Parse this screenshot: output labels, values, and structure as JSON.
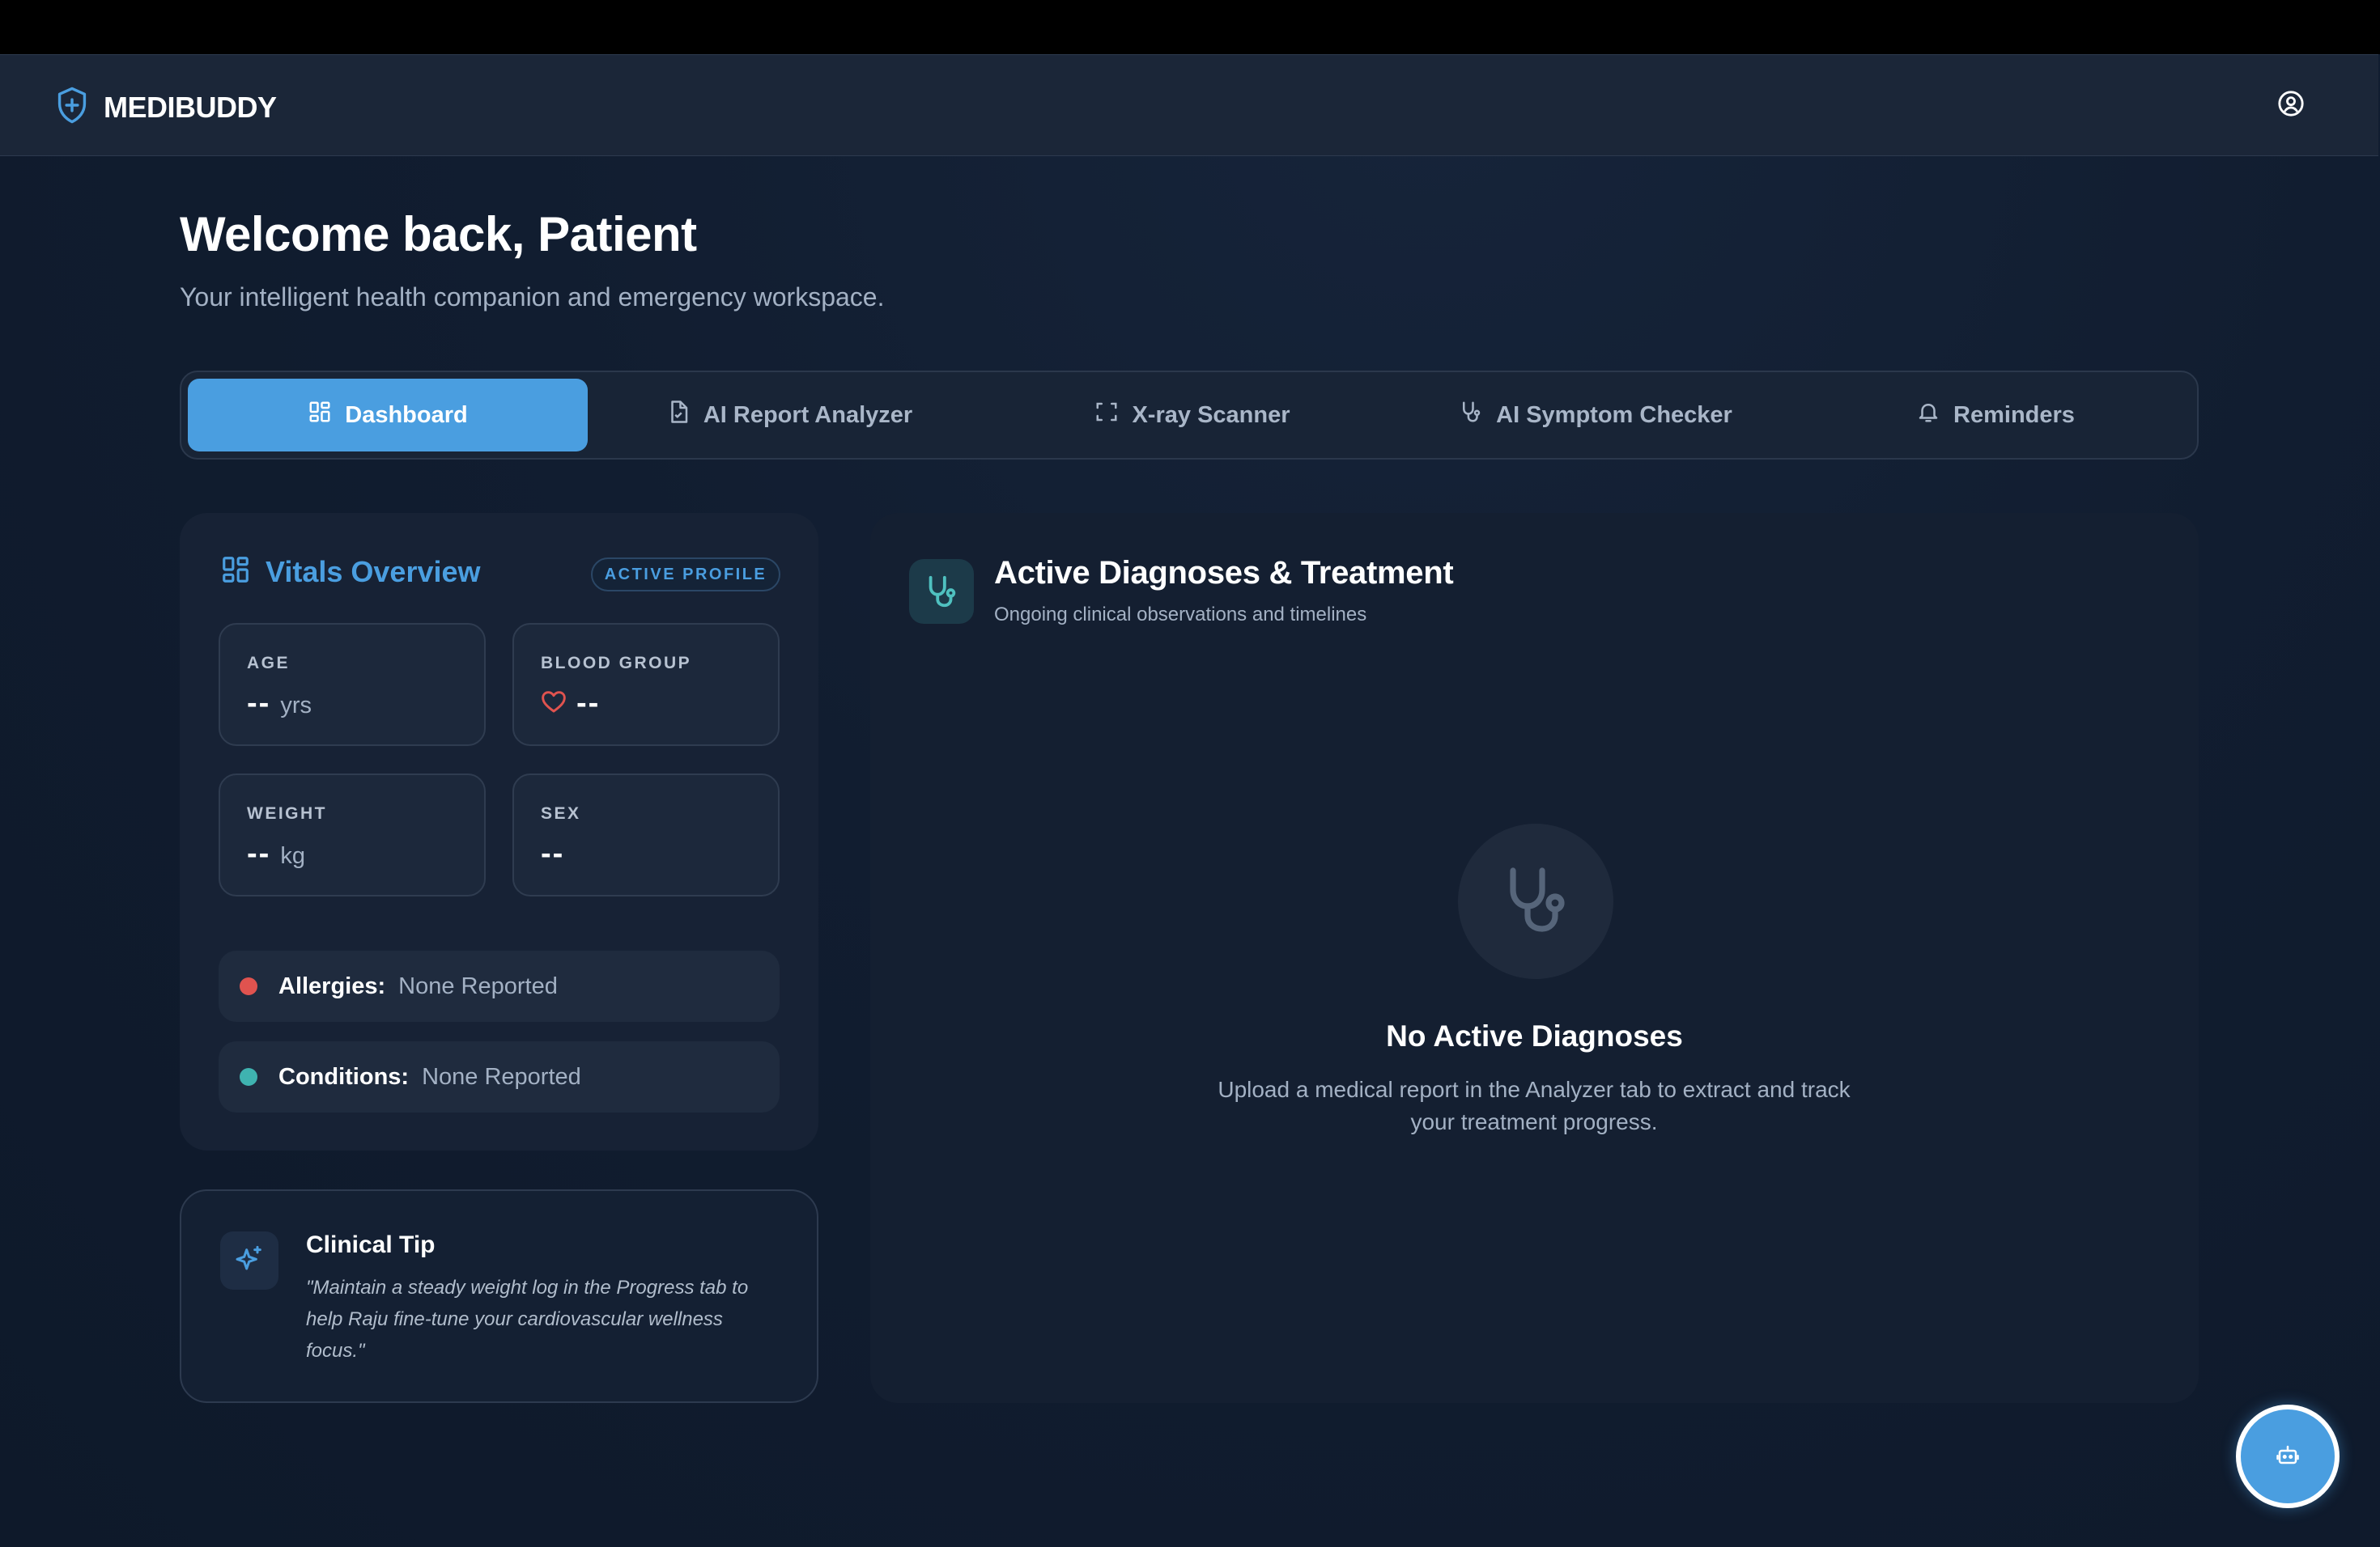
{
  "app": {
    "name": "MEDIBUDDY"
  },
  "header": {
    "welcome": "Welcome back, Patient",
    "subtitle": "Your intelligent health companion and emergency workspace."
  },
  "tabs": [
    {
      "label": "Dashboard",
      "icon": "dashboard-icon",
      "active": true
    },
    {
      "label": "AI Report Analyzer",
      "icon": "document-icon",
      "active": false
    },
    {
      "label": "X-ray Scanner",
      "icon": "scan-icon",
      "active": false
    },
    {
      "label": "AI Symptom Checker",
      "icon": "stethoscope-icon",
      "active": false
    },
    {
      "label": "Reminders",
      "icon": "bell-icon",
      "active": false
    }
  ],
  "vitals": {
    "title": "Vitals Overview",
    "badge": "ACTIVE PROFILE",
    "age": {
      "label": "AGE",
      "value": "--",
      "unit": "yrs"
    },
    "blood_group": {
      "label": "BLOOD GROUP",
      "value": "--"
    },
    "weight": {
      "label": "WEIGHT",
      "value": "--",
      "unit": "kg"
    },
    "sex": {
      "label": "SEX",
      "value": "--"
    },
    "allergies": {
      "label": "Allergies:",
      "value": "None Reported"
    },
    "conditions": {
      "label": "Conditions:",
      "value": "None Reported"
    }
  },
  "tip": {
    "title": "Clinical Tip",
    "text": "\"Maintain a steady weight log in the Progress tab to help Raju fine-tune your cardiovascular wellness focus.\""
  },
  "diagnoses": {
    "title": "Active Diagnoses & Treatment",
    "subtitle": "Ongoing clinical observations and timelines",
    "empty_title": "No Active Diagnoses",
    "empty_text": "Upload a medical report in the Analyzer tab to extract and track your treatment progress."
  },
  "colors": {
    "accent": "#4a9ee0",
    "background": "#0f1b2d",
    "allergy_dot": "#e0534f",
    "condition_dot": "#3fb3b0"
  }
}
